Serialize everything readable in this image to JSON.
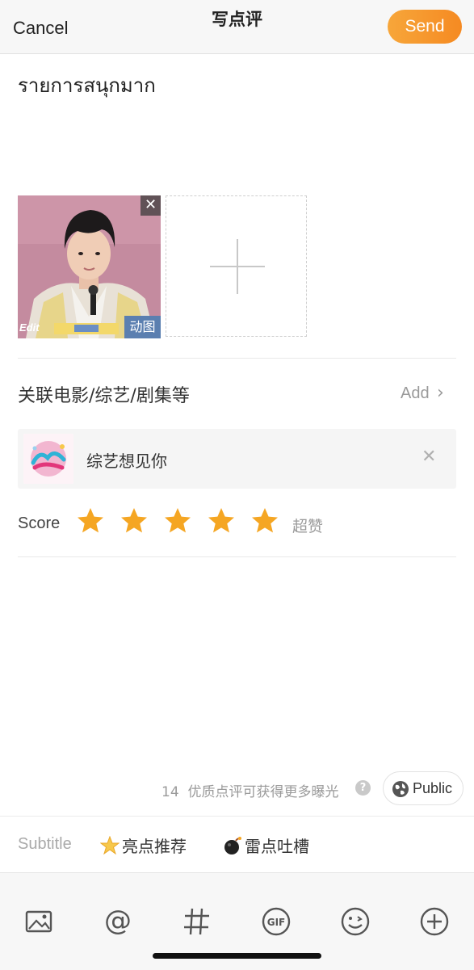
{
  "header": {
    "cancel_label": "Cancel",
    "title": "写点评",
    "send_label": "Send"
  },
  "review": {
    "text": "รายการสนุกมาก"
  },
  "photos": {
    "gif_badge": "动图",
    "edit_label": "Edit"
  },
  "related": {
    "label": "关联电影/综艺/剧集等",
    "add_label": "Add",
    "item": {
      "name": "综艺想见你"
    }
  },
  "score": {
    "label": "Score",
    "stars": 5,
    "max": 5,
    "rating_text": "超赞",
    "star_color": "#f5a623"
  },
  "footer_info": {
    "char_count": "14",
    "hint": "优质点评可获得更多曝光",
    "help": "?",
    "visibility": "Public"
  },
  "subtitle": {
    "label": "Subtitle",
    "tags": [
      "亮点推荐",
      "雷点吐槽"
    ]
  },
  "toolbar": {
    "icons": [
      "image-icon",
      "at-mention-icon",
      "hashtag-icon",
      "gif-icon",
      "emoji-icon",
      "plus-circle-icon"
    ]
  },
  "colors": {
    "accent": "#f58a22",
    "muted": "#9a9a9a"
  }
}
